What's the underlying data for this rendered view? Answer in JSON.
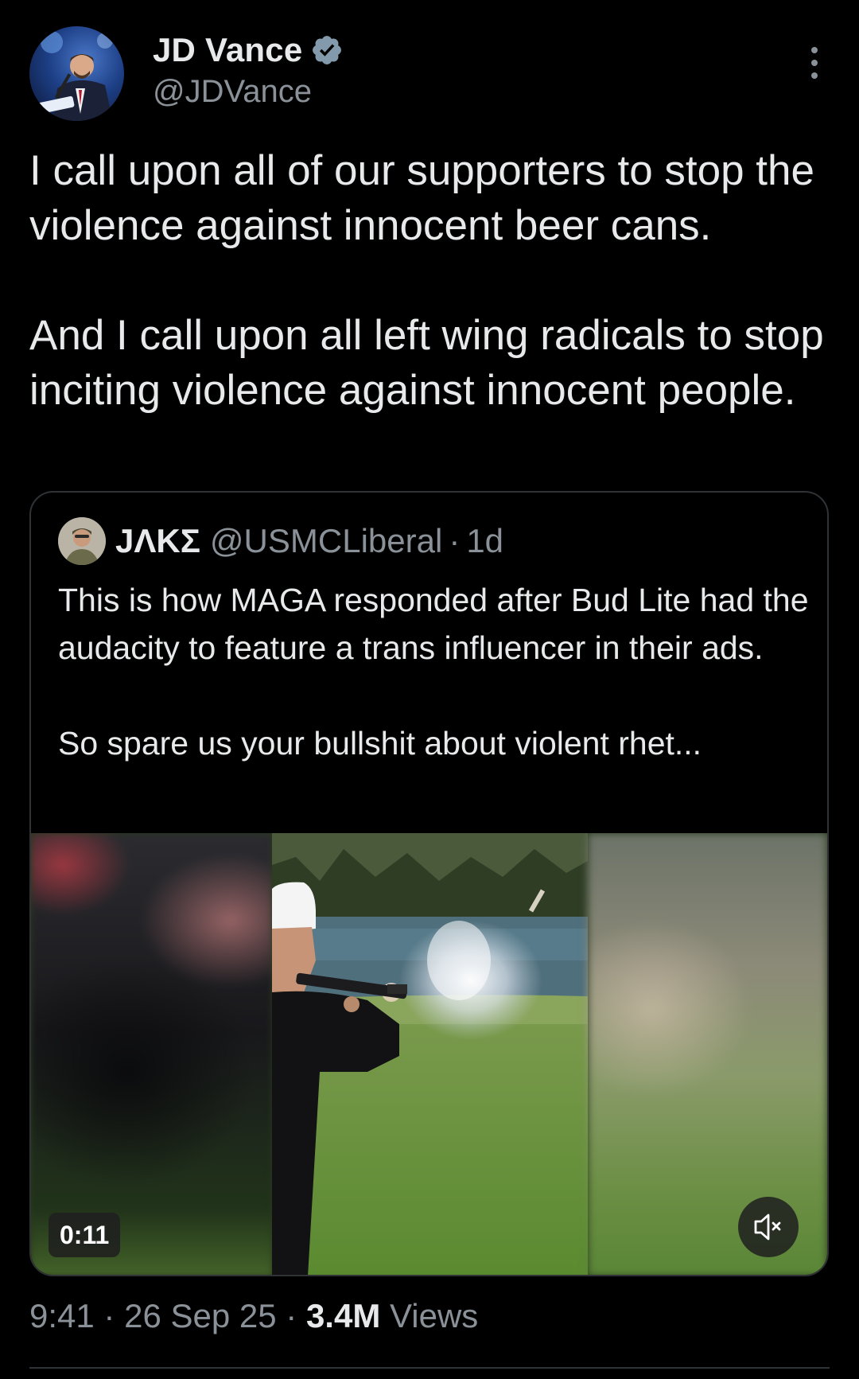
{
  "author": {
    "display_name": "JD Vance",
    "handle": "@JDVance",
    "verified": true
  },
  "tweet": {
    "paragraph_1": "I call upon all of our supporters to stop the violence against innocent beer cans.",
    "paragraph_2": "And I call upon all left wing radicals to stop inciting violence against innocent people."
  },
  "quoted_tweet": {
    "display_name": "JΛKΣ",
    "handle": "@USMCLiberal",
    "separator": "·",
    "time": "1d",
    "paragraph_1": "This is how MAGA responded after Bud Lite had the audacity to feature a trans influencer in their ads.",
    "paragraph_2": "So spare us your bullshit about violent rhet...",
    "video_duration": "0:11",
    "muted": true
  },
  "meta": {
    "time": "9:41",
    "date": "26 Sep 25",
    "separator": "·",
    "views_count": "3.4M",
    "views_label": "Views"
  },
  "colors": {
    "background": "#000000",
    "primary_text": "#e7e9ea",
    "secondary_text": "#8b9198",
    "border": "#2f3336",
    "verified": "#829aab"
  },
  "icons": {
    "verified": "verified-badge-icon",
    "more": "more-vertical-icon",
    "mute": "speaker-muted-icon"
  }
}
